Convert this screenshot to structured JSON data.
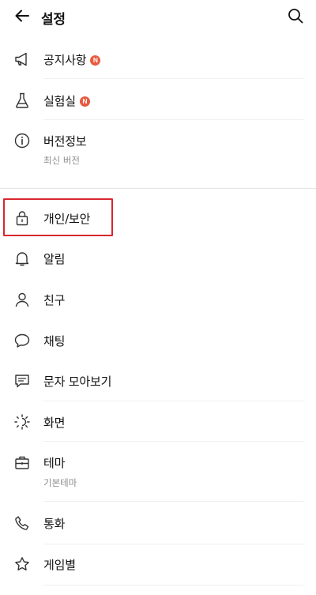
{
  "header": {
    "title": "설정",
    "back_icon": "arrow-left-icon",
    "search_icon": "search-icon"
  },
  "items": [
    {
      "id": "notice",
      "label": "공지사항",
      "badge": "N",
      "icon": "megaphone-icon"
    },
    {
      "id": "lab",
      "label": "실험실",
      "badge": "N",
      "icon": "flask-icon"
    },
    {
      "id": "version",
      "label": "버전정보",
      "sub": "최신 버전",
      "icon": "info-icon"
    },
    {
      "id": "privacy",
      "label": "개인/보안",
      "icon": "lock-icon"
    },
    {
      "id": "alarm",
      "label": "알림",
      "icon": "bell-icon"
    },
    {
      "id": "friends",
      "label": "친구",
      "icon": "person-icon"
    },
    {
      "id": "chat",
      "label": "채팅",
      "icon": "chat-bubble-icon"
    },
    {
      "id": "sms",
      "label": "문자 모아보기",
      "icon": "message-icon"
    },
    {
      "id": "screen",
      "label": "화면",
      "icon": "brightness-icon"
    },
    {
      "id": "theme",
      "label": "테마",
      "sub": "기본테마",
      "icon": "theme-icon"
    },
    {
      "id": "call",
      "label": "통화",
      "icon": "phone-icon"
    },
    {
      "id": "game",
      "label": "게임별",
      "icon": "star-icon"
    }
  ],
  "colors": {
    "badge": "#e85a3f",
    "highlight": "#d8262f",
    "subtext": "#8c8c8c"
  }
}
